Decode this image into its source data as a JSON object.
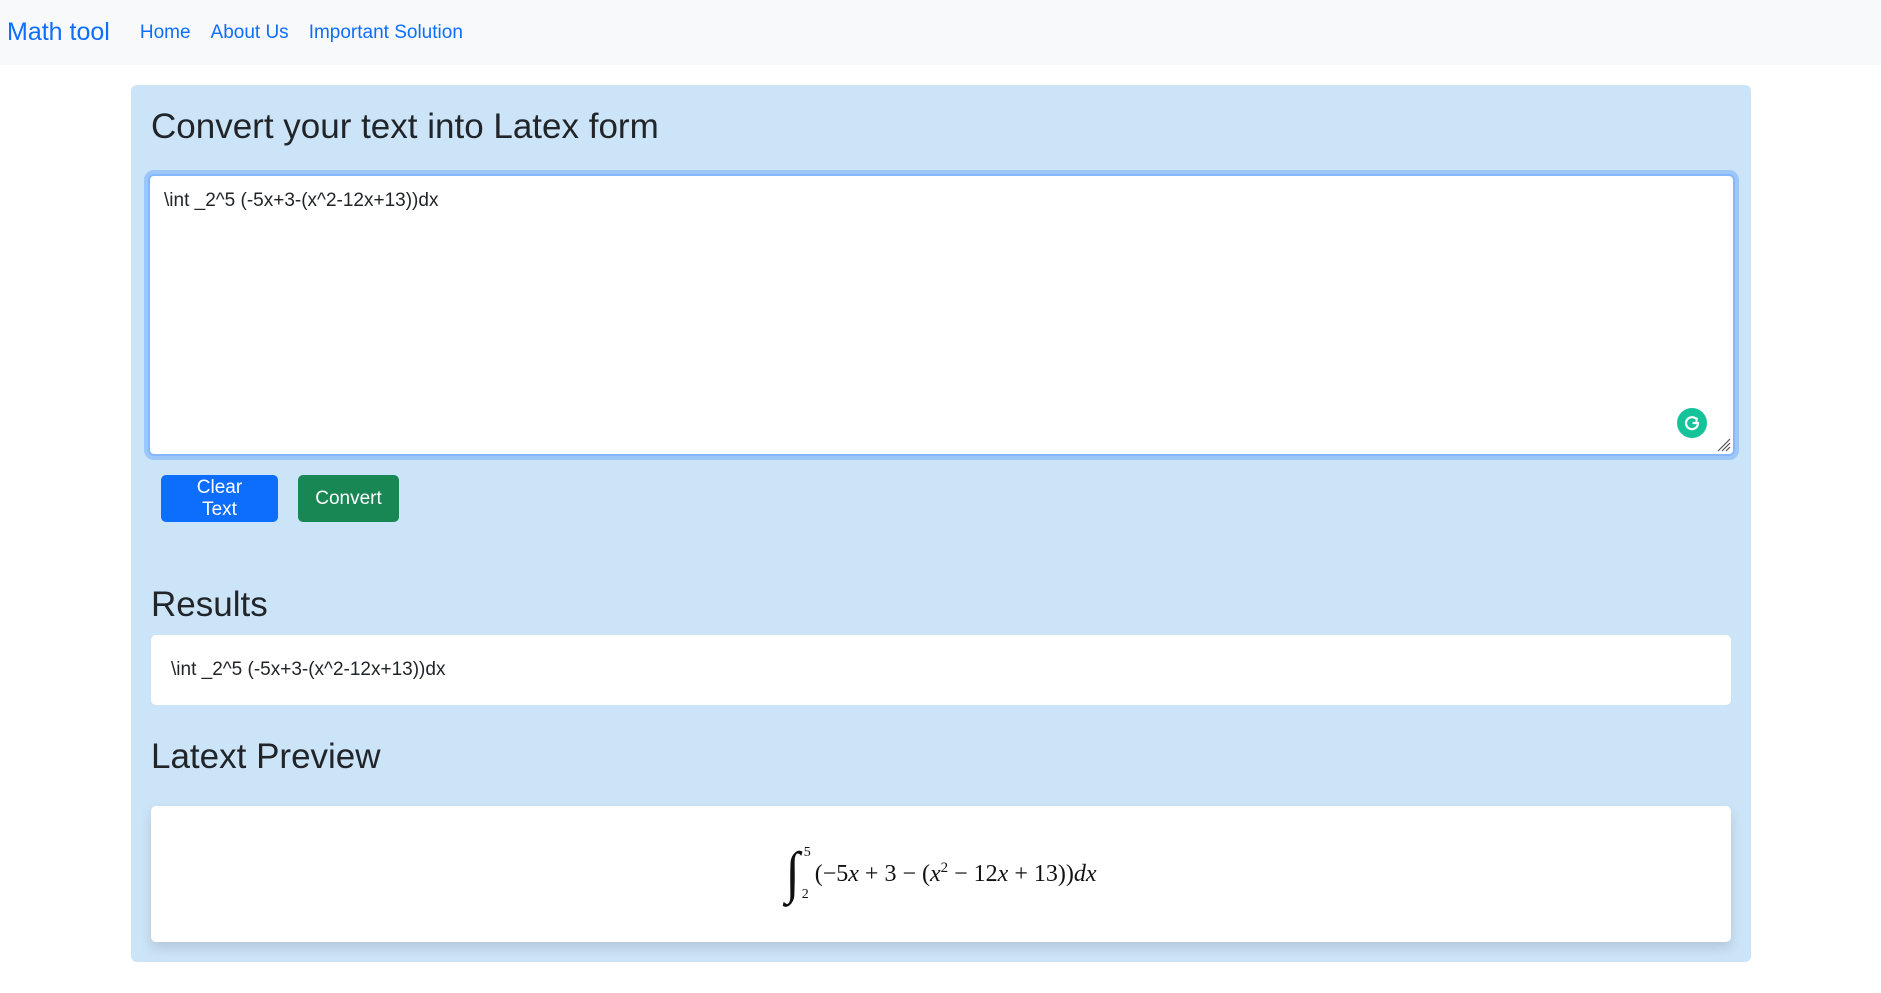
{
  "navbar": {
    "brand": "Math tool",
    "links": [
      "Home",
      "About Us",
      "Important Solution"
    ]
  },
  "main": {
    "title": "Convert your text into Latex form",
    "input_value": "\\int _2^5 (-5x+3-(x^2-12x+13))dx",
    "buttons": {
      "clear_label": "Clear Text",
      "convert_label": "Convert"
    },
    "results_heading": "Results",
    "results_text": "\\int _2^5 (-5x+3-(x^2-12x+13))dx",
    "preview_heading": "Latext Preview",
    "preview": {
      "upper_limit": "5",
      "lower_limit": "2",
      "expression_parts": [
        "(−5",
        "x",
        " + 3 − (",
        "x",
        "2",
        " − 12",
        "x",
        " + 13))",
        "dx"
      ]
    }
  },
  "colors": {
    "brand": "#0d6efd",
    "panel_background": "#cce4f7",
    "clear_button": "#0d6efd",
    "convert_button": "#198754",
    "grammarly_icon": "#15c39a"
  },
  "icons": [
    "grammarly-icon",
    "resize-handle-icon"
  ]
}
